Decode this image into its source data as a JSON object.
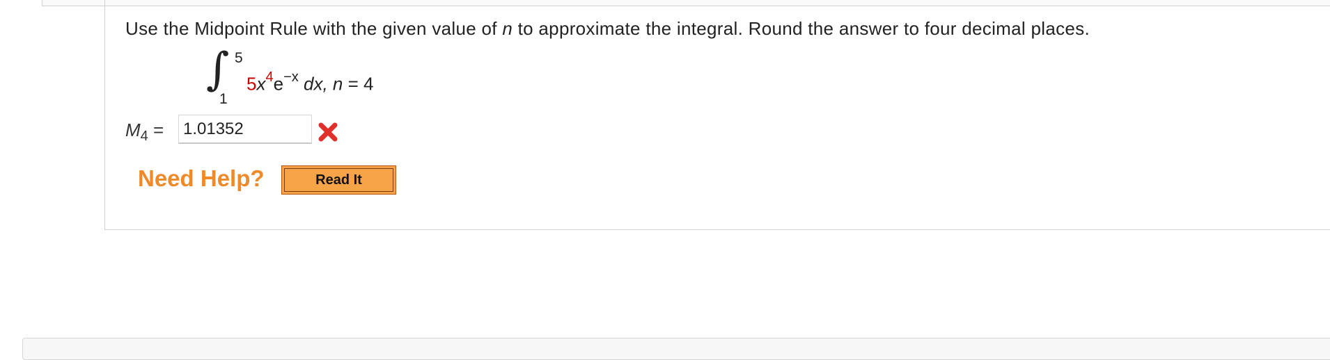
{
  "question": {
    "prompt_before": "Use the Midpoint Rule with the given value of ",
    "prompt_var": "n",
    "prompt_after": " to approximate the integral. Round the answer to four decimal places."
  },
  "integral": {
    "upper_limit": "5",
    "lower_limit": "1",
    "coefficient": "5",
    "base": "x",
    "exponent": "4",
    "exp_base": "e",
    "exp_power": "−x",
    "differential": "dx,",
    "param_var": "n",
    "param_eq": " = 4"
  },
  "answer": {
    "label_var": "M",
    "label_sub": "4",
    "label_eq": " = ",
    "value": "1.01352",
    "status_icon": "wrong-x-icon",
    "status_color": "#e0302b"
  },
  "help": {
    "label": "Need Help?",
    "button_label": "Read It",
    "accent_color": "#ef8a2b"
  }
}
